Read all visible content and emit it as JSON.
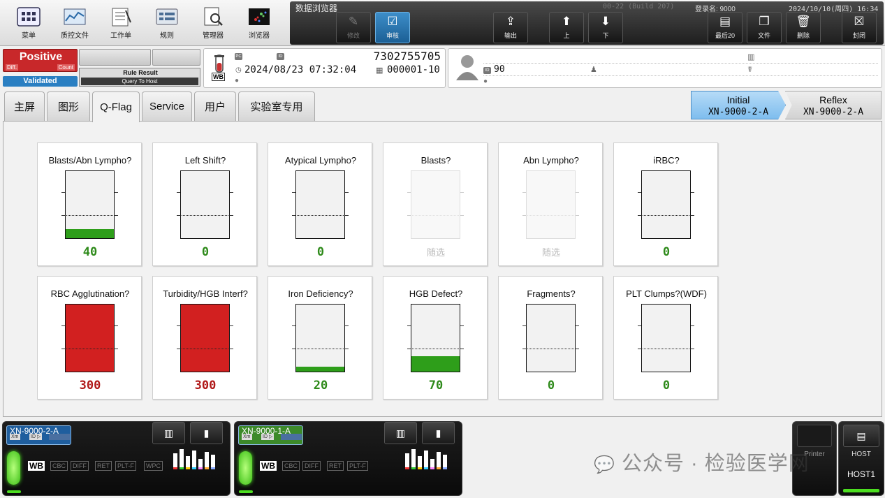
{
  "toolbar": {
    "items": [
      {
        "label": "菜单",
        "icon": "menu-grid-icon"
      },
      {
        "label": "质控文件",
        "icon": "qc-chart-icon"
      },
      {
        "label": "工作单",
        "icon": "worklist-icon"
      },
      {
        "label": "规则",
        "icon": "rules-icon"
      },
      {
        "label": "管理器",
        "icon": "manager-icon"
      },
      {
        "label": "浏览器",
        "icon": "browser-scatter-icon"
      }
    ]
  },
  "browser": {
    "title": "数据浏览器",
    "build": "00-22 (Build 207)",
    "login": "登录名: 9000",
    "datetime": "2024/10/10(周四) 16:34",
    "buttons": {
      "modify": "修改",
      "validate": "审核",
      "output": "输出",
      "up": "上",
      "down": "下",
      "last20": "最后20",
      "file": "文件",
      "delete": "删除",
      "close": "封闭"
    }
  },
  "status": {
    "positive": "Positive",
    "diff": "Diff.",
    "count": "Count",
    "validated": "Validated",
    "rule_result": "Rule Result",
    "query": "Query To Host"
  },
  "sample": {
    "type": "WB",
    "number": "7302755705",
    "datetime": "2024/08/23 07:32:04",
    "rack": "000001-10"
  },
  "patient": {
    "id": "90"
  },
  "tabs": [
    "主屏",
    "图形",
    "Q-Flag",
    "Service",
    "用户",
    "实验室专用"
  ],
  "selected_tab": "Q-Flag",
  "runs": {
    "initial": {
      "title": "Initial",
      "analyzer": "XN-9000-2-A"
    },
    "reflex": {
      "title": "Reflex",
      "analyzer": "XN-9000-2-A"
    }
  },
  "qflags": [
    {
      "name": "Blasts/Abn Lympho?",
      "value": "40",
      "level": 0.14,
      "color": "#2e9e1a",
      "enabled": true
    },
    {
      "name": "Left Shift?",
      "value": "0",
      "level": 0,
      "color": "#2e9e1a",
      "enabled": true
    },
    {
      "name": "Atypical Lympho?",
      "value": "0",
      "level": 0,
      "color": "#2e9e1a",
      "enabled": true
    },
    {
      "name": "Blasts?",
      "value": "随选",
      "level": 0,
      "color": "#2e9e1a",
      "enabled": false
    },
    {
      "name": "Abn Lympho?",
      "value": "随选",
      "level": 0,
      "color": "#2e9e1a",
      "enabled": false
    },
    {
      "name": "iRBC?",
      "value": "0",
      "level": 0,
      "color": "#2e9e1a",
      "enabled": true
    },
    {
      "name": "RBC Agglutination?",
      "value": "300",
      "level": 1.0,
      "color": "#d22020",
      "enabled": true
    },
    {
      "name": "Turbidity/HGB Interf?",
      "value": "300",
      "level": 1.0,
      "color": "#d22020",
      "enabled": true
    },
    {
      "name": "Iron Deficiency?",
      "value": "20",
      "level": 0.07,
      "color": "#2e9e1a",
      "enabled": true
    },
    {
      "name": "HGB Defect?",
      "value": "70",
      "level": 0.23,
      "color": "#2e9e1a",
      "enabled": true
    },
    {
      "name": "Fragments?",
      "value": "0",
      "level": 0,
      "color": "#2e9e1a",
      "enabled": true
    },
    {
      "name": "PLT Clumps?(WDF)",
      "value": "0",
      "level": 0,
      "color": "#2e9e1a",
      "enabled": true
    }
  ],
  "analyzers": [
    {
      "name": "XN-9000-2-A",
      "color": "#1f5e9e",
      "mode": "WB",
      "modes": [
        "CBC",
        "DIFF",
        "RET",
        "PLT-F",
        "WPC"
      ]
    },
    {
      "name": "XN-9000-1-A",
      "color": "#3c8a2a",
      "mode": "WB",
      "modes": [
        "CBC",
        "DIFF",
        "RET",
        "PLT-F"
      ]
    }
  ],
  "analyzer_small": [
    "Xm",
    "ID ▷"
  ],
  "printer": {
    "label": "Printer"
  },
  "host": {
    "label": "HOST",
    "name": "HOST1"
  },
  "watermark": "公众号 · 检验医学网"
}
